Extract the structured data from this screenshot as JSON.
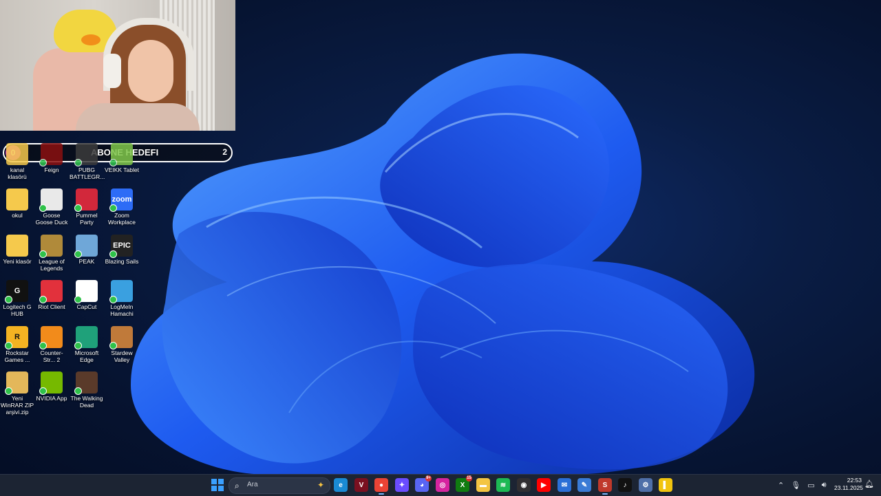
{
  "goal": {
    "start": "0",
    "title": "ABONE HEDEFI",
    "end": "2"
  },
  "desktop": {
    "icons": [
      {
        "label": "kanal klasörü",
        "icon": "folder-icon",
        "color": "#f5c94c"
      },
      {
        "label": "Feign",
        "icon": "feign-icon",
        "color": "#8b1010"
      },
      {
        "label": "PUBG BATTLEGR...",
        "icon": "pubg-icon",
        "color": "#3b3b3b"
      },
      {
        "label": "VEIKK Tablet",
        "icon": "veikk-icon",
        "color": "#7fc64a"
      },
      {
        "label": "okul",
        "icon": "folder-icon",
        "color": "#f5c94c"
      },
      {
        "label": "Goose Goose Duck",
        "icon": "goose-icon",
        "color": "#e9e9e9"
      },
      {
        "label": "Pummel Party",
        "icon": "pummel-party-icon",
        "color": "#d2283b"
      },
      {
        "label": "Zoom Workplace",
        "icon": "zoom-icon",
        "color": "#2d6cf6",
        "text": "zoom"
      },
      {
        "label": "Yeni klasör",
        "icon": "folder-icon",
        "color": "#f5c94c"
      },
      {
        "label": "League of Legends",
        "icon": "league-icon",
        "color": "#b08a3a"
      },
      {
        "label": "PEAK",
        "icon": "peak-icon",
        "color": "#6fa7d8"
      },
      {
        "label": "Blazing Sails",
        "icon": "epic-games-icon",
        "color": "#222222",
        "text": "EPIC"
      },
      {
        "label": "Logitech G HUB",
        "icon": "logitech-icon",
        "color": "#111111",
        "text": "G"
      },
      {
        "label": "Riot Client",
        "icon": "riot-icon",
        "color": "#e2313c"
      },
      {
        "label": "CapCut",
        "icon": "capcut-icon",
        "color": "#ffffff"
      },
      {
        "label": "LogMeIn Hamachi",
        "icon": "hamachi-icon",
        "color": "#3aa0e0"
      },
      {
        "label": "Rockstar Games ...",
        "icon": "rockstar-icon",
        "color": "#f4b322",
        "text": "R"
      },
      {
        "label": "Counter-Str... 2",
        "icon": "counter-strike-icon",
        "color": "#f28b1b"
      },
      {
        "label": "Microsoft Edge",
        "icon": "edge-icon",
        "color": "#1fa17a"
      },
      {
        "label": "Stardew Valley",
        "icon": "stardew-icon",
        "color": "#c07a3a"
      },
      {
        "label": "Yeni WinRAR ZIP arşivi.zip",
        "icon": "winrar-icon",
        "color": "#e3b75a"
      },
      {
        "label": "NVIDIA App",
        "icon": "nvidia-icon",
        "color": "#76b900"
      },
      {
        "label": "The Walking Dead",
        "icon": "walking-dead-icon",
        "color": "#5a3a2a"
      }
    ]
  },
  "taskbar": {
    "search_placeholder": "Ara",
    "apps": [
      {
        "name": "edge-icon",
        "color": "#1a8ad4",
        "text": "e"
      },
      {
        "name": "davinci-icon",
        "color": "#7a1020",
        "text": "V"
      },
      {
        "name": "chrome-icon",
        "color": "#ea4335",
        "text": "●"
      },
      {
        "name": "copilot-icon",
        "color": "#6a4cff",
        "text": "✦"
      },
      {
        "name": "discord-icon",
        "color": "#5865f2",
        "text": "◕",
        "badge": "9+"
      },
      {
        "name": "instagram-icon",
        "color": "#d6249f",
        "text": "◎"
      },
      {
        "name": "xbox-icon",
        "color": "#107c10",
        "text": "X",
        "badge": "15"
      },
      {
        "name": "file-explorer-icon",
        "color": "#f4c542",
        "text": "▬"
      },
      {
        "name": "spotify-icon",
        "color": "#1db954",
        "text": "≋"
      },
      {
        "name": "obs-icon",
        "color": "#302e31",
        "text": "◉"
      },
      {
        "name": "youtube-icon",
        "color": "#ff0000",
        "text": "▶"
      },
      {
        "name": "mail-icon",
        "color": "#2b6fd6",
        "text": "✉"
      },
      {
        "name": "notepad-icon",
        "color": "#3a7bd5",
        "text": "✎"
      },
      {
        "name": "steam-icon",
        "color": "#c0392b",
        "text": "S"
      },
      {
        "name": "tiktok-icon",
        "color": "#111111",
        "text": "♪"
      },
      {
        "name": "settings-icon",
        "color": "#4f6fa8",
        "text": "⚙"
      },
      {
        "name": "sticky-icon",
        "color": "#f1c40f",
        "text": "▌"
      }
    ],
    "clock_time": "22:53",
    "clock_date": "23.11.2025"
  }
}
